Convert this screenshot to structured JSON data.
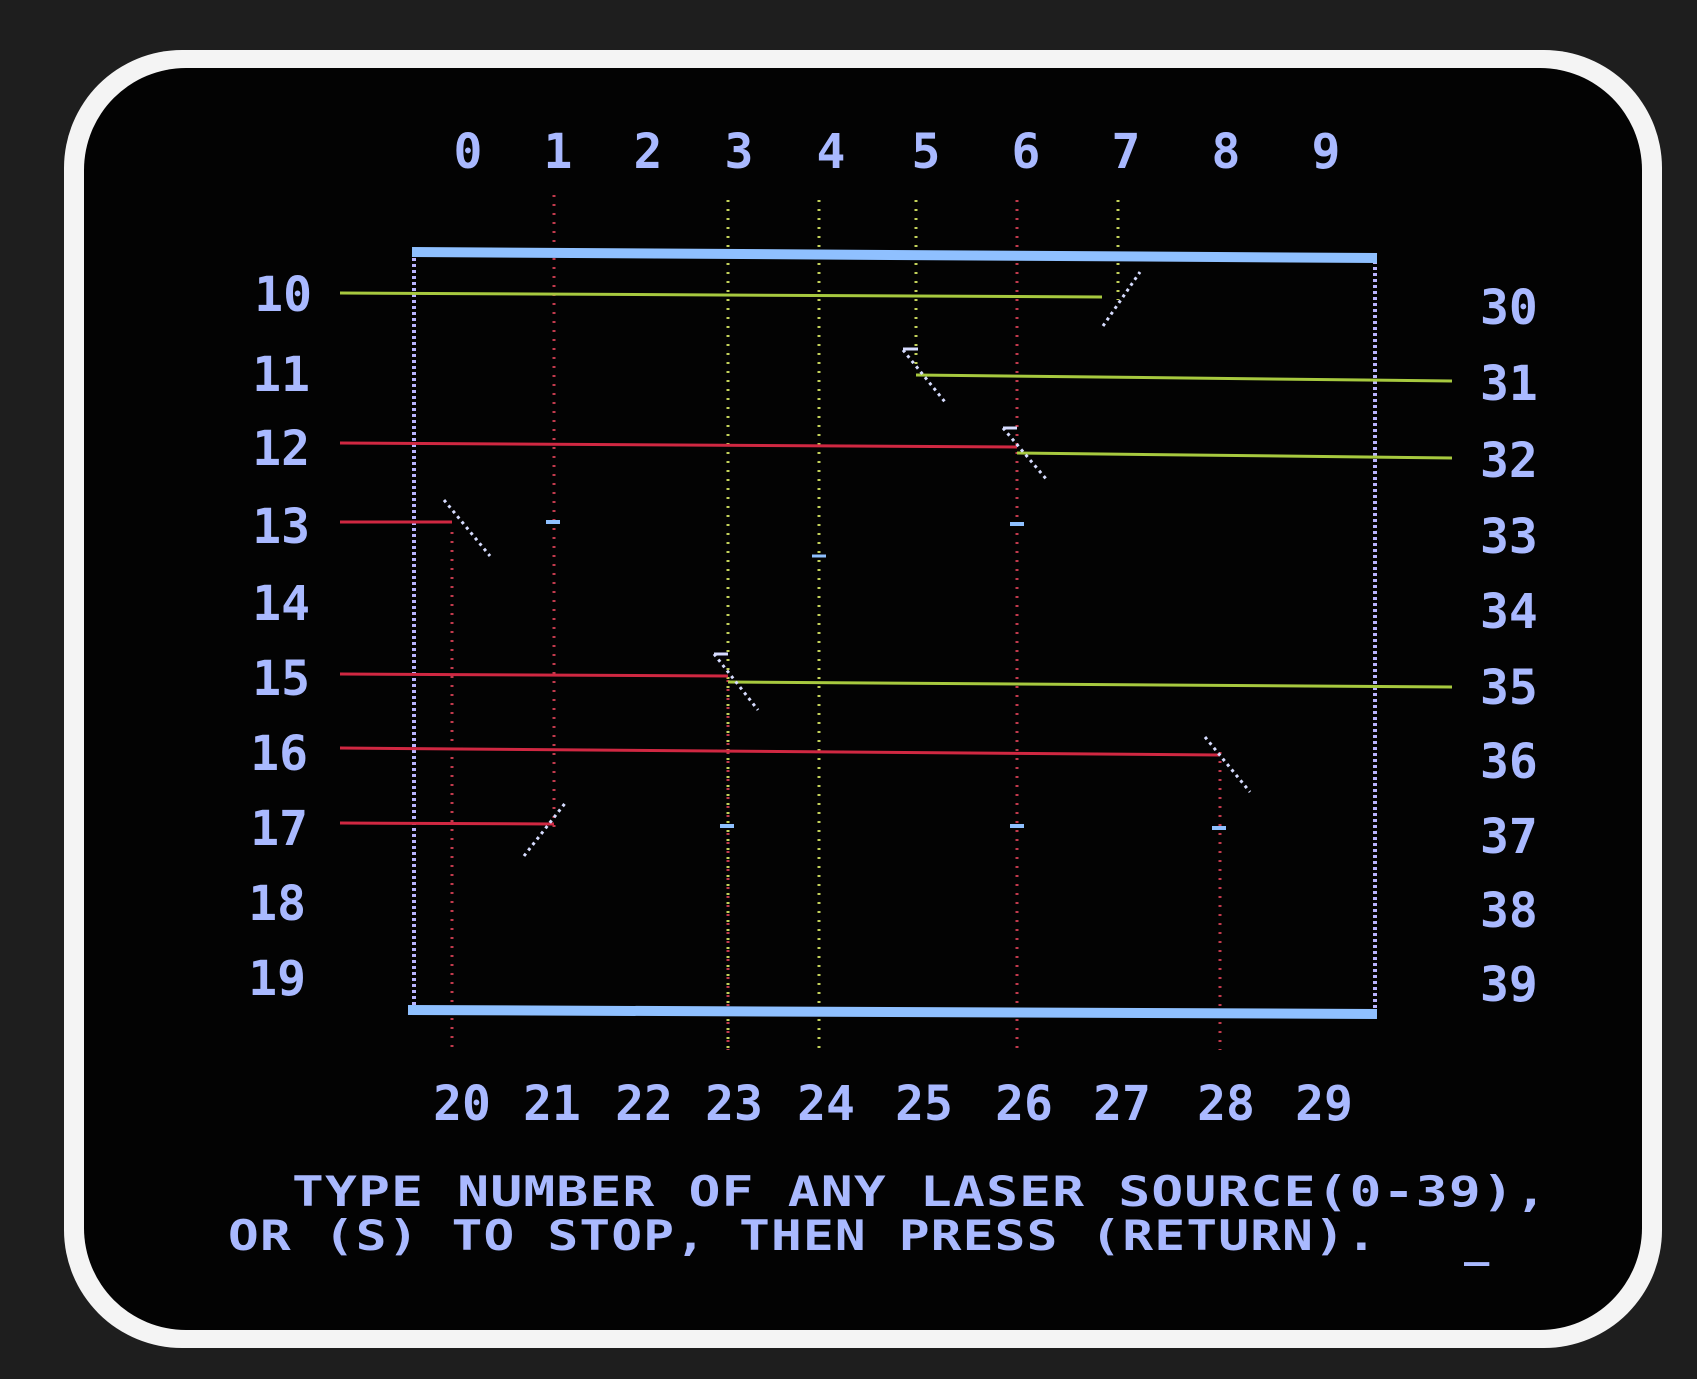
{
  "colors": {
    "screen": "#030303",
    "bezel": "#1e1e1e",
    "crt_border": "#f4f4f4",
    "box_edge": "#8fc0ff",
    "box_side": "#b9b4ff",
    "text": "#a9b9ff",
    "beam_green": "#a7c93f",
    "beam_red": "#d02842",
    "dot_green": "#c3d25a",
    "dot_red": "#c23a4c",
    "mirror": "#d6dcff"
  },
  "labels": {
    "top": [
      "0",
      "1",
      "2",
      "3",
      "4",
      "5",
      "6",
      "7",
      "8",
      "9"
    ],
    "left": [
      "10",
      "11",
      "12",
      "13",
      "14",
      "15",
      "16",
      "17",
      "18",
      "19"
    ],
    "bottom": [
      "20",
      "21",
      "22",
      "23",
      "24",
      "25",
      "26",
      "27",
      "28",
      "29"
    ],
    "right": [
      "30",
      "31",
      "32",
      "33",
      "34",
      "35",
      "36",
      "37",
      "38",
      "39"
    ]
  },
  "prompt": {
    "line1": "TYPE NUMBER OF ANY LASER SOURCE(0-39),",
    "line2": "OR (S) TO STOP, THEN PRESS (RETURN).",
    "cursor": "_"
  }
}
